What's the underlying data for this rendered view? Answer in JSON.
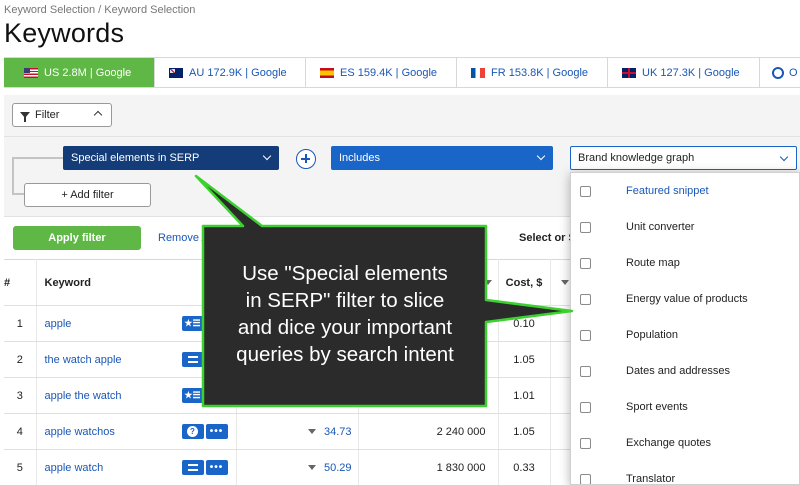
{
  "breadcrumb": "Keyword Selection / Keyword Selection",
  "page_title": "Keywords",
  "tabs": [
    {
      "flag": "us-flag",
      "label": "US 2.8M | Google",
      "active": true
    },
    {
      "flag": "au-flag",
      "label": "AU 172.9K | Google"
    },
    {
      "flag": "es-flag",
      "label": "ES 159.4K | Google"
    },
    {
      "flag": "fr-flag",
      "label": "FR 153.8K | Google"
    },
    {
      "flag": "uk-flag",
      "label": "UK 127.3K | Google"
    },
    {
      "flag": "globe-icon",
      "label": "O"
    }
  ],
  "filter_toggle": {
    "label": "Filter"
  },
  "filter_builder": {
    "field_select": "Special elements in SERP",
    "operator_select": "Includes",
    "value_select": "Brand knowledge graph",
    "add_filter": "+ Add filter"
  },
  "actions": {
    "apply": "Apply filter",
    "remove": "Remove A",
    "select_or": "Select or Sa"
  },
  "table": {
    "headers": {
      "num": "#",
      "keyword": "Keyword",
      "cost": "Cost, $"
    },
    "rows": [
      {
        "num": "1",
        "keyword": "apple",
        "badges": [
          "star-list",
          "more"
        ],
        "volume": "",
        "results": "",
        "cost": "0.10"
      },
      {
        "num": "2",
        "keyword": "the watch apple",
        "badges": [
          "lines",
          "more"
        ],
        "volume": "",
        "results": "",
        "cost": "1.05"
      },
      {
        "num": "3",
        "keyword": "apple the watch",
        "badges": [
          "star-list",
          "more"
        ],
        "volume": "",
        "results": "",
        "cost": "1.01"
      },
      {
        "num": "4",
        "keyword": "apple watchos",
        "badges": [
          "question",
          "more"
        ],
        "volume": "34.73",
        "results": "2 240 000",
        "cost": "1.05"
      },
      {
        "num": "5",
        "keyword": "apple watch",
        "badges": [
          "lines",
          "more"
        ],
        "volume": "50.29",
        "results": "1 830 000",
        "cost": "0.33"
      }
    ]
  },
  "dropdown": {
    "items": [
      "Featured snippet",
      "Unit converter",
      "Route map",
      "Energy value of products",
      "Population",
      "Dates and addresses",
      "Sport events",
      "Exchange quotes",
      "Translator"
    ]
  },
  "callout": {
    "lines": [
      "Use \"Special elements",
      "in SERP\" filter to slice",
      "and dice your important",
      "queries by search intent"
    ],
    "fill": "#2b2b2b",
    "stroke": "#3cd12f"
  },
  "colors": {
    "accent_green": "#5fb845",
    "link_blue": "#1a57b6",
    "select_blue": "#1a65c8",
    "select_dark": "#143c78"
  }
}
